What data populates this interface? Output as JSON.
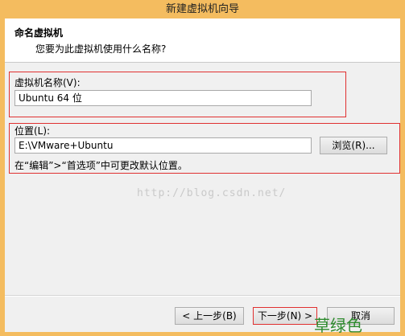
{
  "window": {
    "title": "新建虚拟机向导"
  },
  "header": {
    "title": "命名虚拟机",
    "subtitle": "您要为此虚拟机使用什么名称?"
  },
  "name_section": {
    "label": "虚拟机名称(V):",
    "value": "Ubuntu 64 位"
  },
  "location_section": {
    "label": "位置(L):",
    "value": "E:\\VMware+Ubuntu",
    "browse_label": "浏览(R)...",
    "hint": "在“编辑”>“首选项”中可更改默认位置。"
  },
  "footer": {
    "back_label": "< 上一步(B)",
    "next_label": "下一步(N) >",
    "cancel_label": "取消"
  },
  "overlay": {
    "watermark": "http://blog.csdn.net/",
    "annotation": "草绿色"
  }
}
